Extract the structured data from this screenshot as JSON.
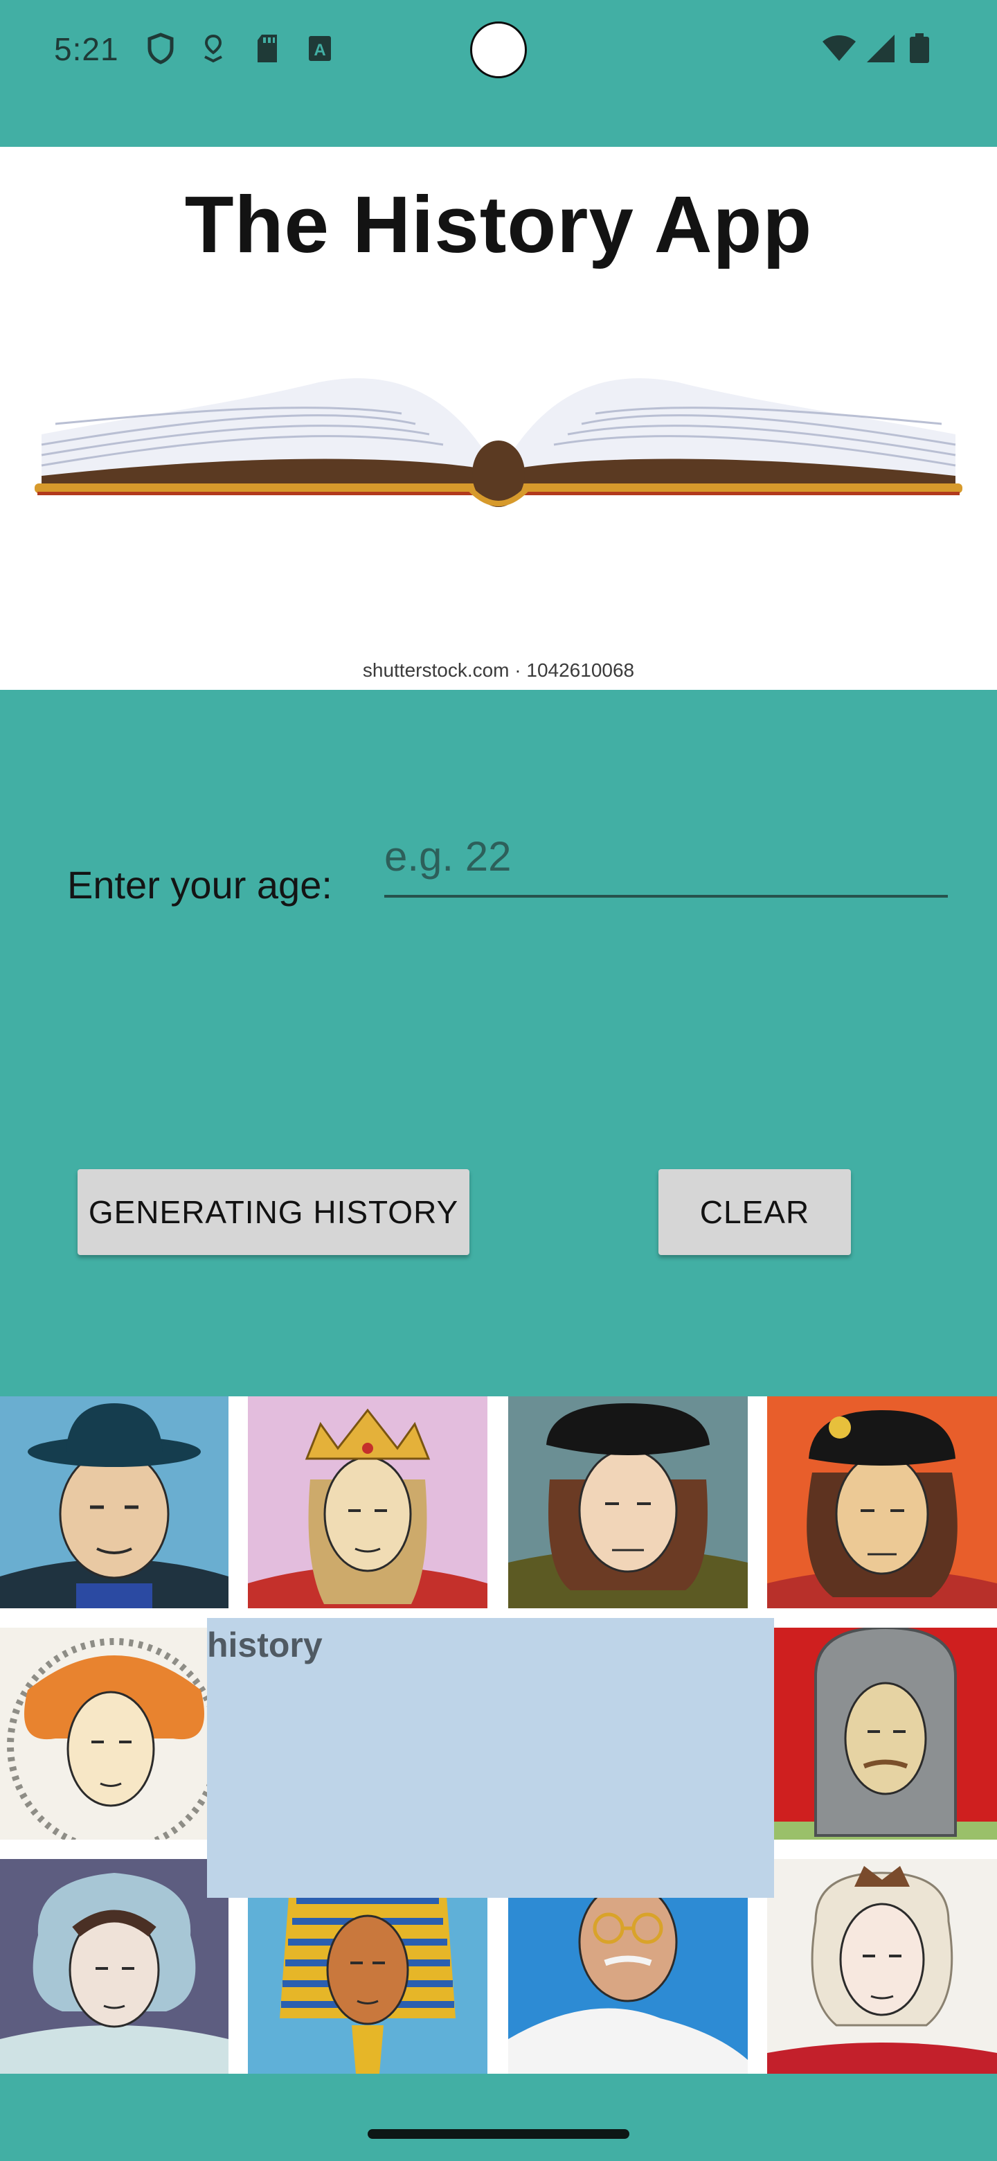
{
  "status_bar": {
    "time": "5:21",
    "left_icons": [
      "shield-icon",
      "location-pin-icon",
      "sd-card-icon",
      "font-a-icon"
    ],
    "right_icons": [
      "wifi-icon",
      "signal-icon",
      "battery-icon"
    ]
  },
  "header": {
    "title": "The History App",
    "image": "open-book-illustration",
    "watermark": "shutterstock.com · 1042610068"
  },
  "form": {
    "age_label": "Enter your age:",
    "age_input": {
      "value": "",
      "placeholder": "e.g. 22"
    },
    "generate_button_label": "GENERATING HISTORY",
    "clear_button_label": "CLEAR"
  },
  "history_output": {
    "label": "history"
  },
  "portraits": [
    "winston-churchill-portrait",
    "crowned-queen-portrait",
    "henry-vii-portrait",
    "richard-iii-portrait",
    "elizabeth-i-portrait",
    "chainmail-knight-portrait",
    "jane-austen-portrait",
    "pharaoh-portrait",
    "mahatma-gandhi-portrait",
    "queen-victoria-portrait"
  ],
  "colors": {
    "background": "#42afa4",
    "header_panel": "#ffffff",
    "button": "#d6d6d6",
    "history_box": "#bed4e8"
  }
}
